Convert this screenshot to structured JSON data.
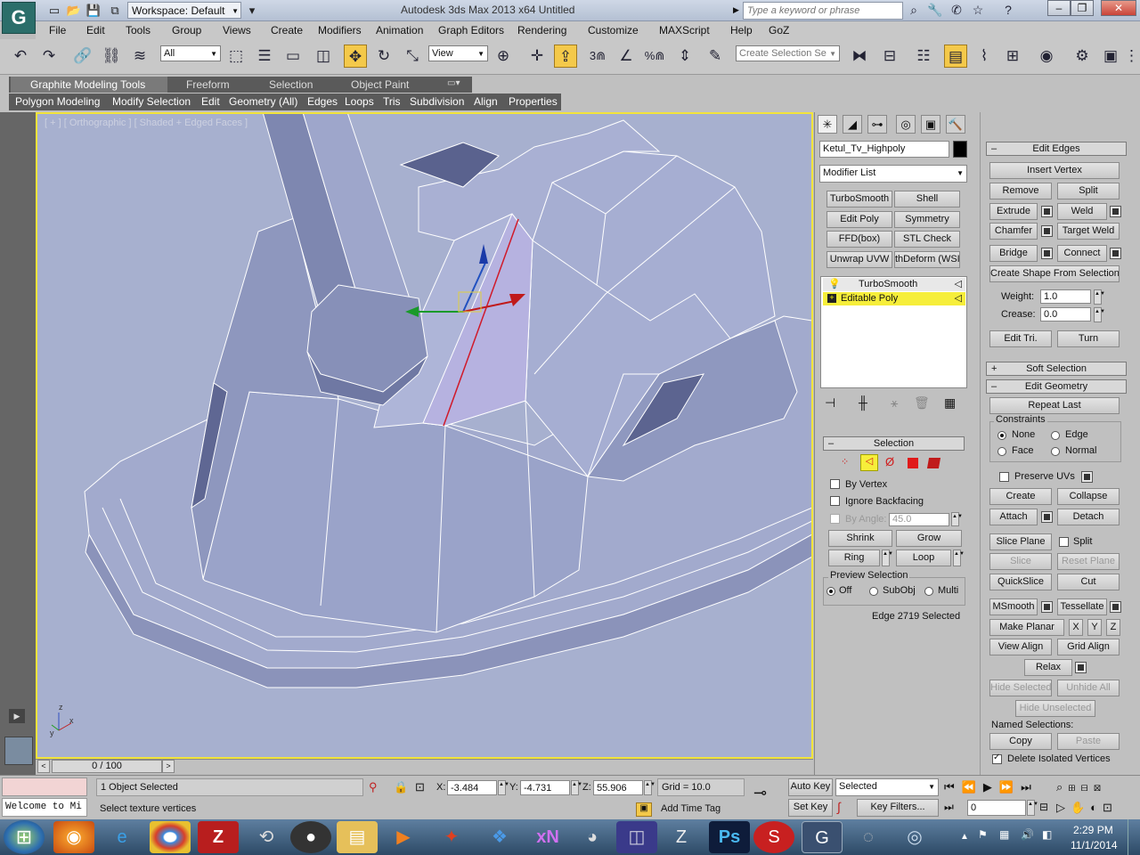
{
  "titlebar": {
    "workspace": "Workspace: Default",
    "window_title": "Autodesk 3ds Max  2013 x64      Untitled",
    "search_placeholder": "Type a keyword or phrase"
  },
  "menu": [
    "File",
    "Edit",
    "Tools",
    "Group",
    "Views",
    "Create",
    "Modifiers",
    "Animation",
    "Graph Editors",
    "Rendering",
    "Customize",
    "MAXScript",
    "Help",
    "GoZ"
  ],
  "toolbar": {
    "filter_value": "All",
    "ref_coord": "View",
    "selection_set_placeholder": "Create Selection Se",
    "snap_numbers": [
      "3",
      "%"
    ]
  },
  "ribbon": {
    "tabs": [
      "Graphite Modeling Tools",
      "Freeform",
      "Selection",
      "Object Paint"
    ],
    "subtabs": [
      "Polygon Modeling",
      "Modify Selection",
      "Edit",
      "Geometry (All)",
      "Edges",
      "Loops",
      "Tris",
      "Subdivision",
      "Align",
      "Properties"
    ]
  },
  "viewport": {
    "label": "[ + ] [ Orthographic ] [ Shaded + Edged Faces ]",
    "axis_labels": [
      "z",
      "x",
      "y"
    ]
  },
  "timeslider": {
    "value": "0 / 100"
  },
  "command_panel": {
    "object_name": "Ketul_Tv_Highpoly",
    "modifier_list": "Modifier List",
    "modifier_buttons": [
      "TurboSmooth",
      "Shell",
      "Edit Poly",
      "Symmetry",
      "FFD(box)",
      "STL Check",
      "Unwrap UVW",
      "thDeform (WSI"
    ],
    "stack": [
      "TurboSmooth",
      "Editable Poly"
    ],
    "selection": {
      "title": "Selection",
      "by_vertex": "By Vertex",
      "ignore_backfacing": "Ignore Backfacing",
      "by_angle": "By Angle:",
      "angle_value": "45.0",
      "shrink": "Shrink",
      "grow": "Grow",
      "ring": "Ring",
      "loop": "Loop",
      "preview_title": "Preview Selection",
      "preview_options": [
        "Off",
        "SubObj",
        "Multi"
      ],
      "status": "Edge 2719 Selected"
    }
  },
  "edit_edges": {
    "title": "Edit Edges",
    "insert_vertex": "Insert Vertex",
    "remove": "Remove",
    "split": "Split",
    "extrude": "Extrude",
    "weld": "Weld",
    "chamfer": "Chamfer",
    "target_weld": "Target Weld",
    "bridge": "Bridge",
    "connect": "Connect",
    "create_shape": "Create Shape From Selection",
    "weight_label": "Weight:",
    "weight_value": "1.0",
    "crease_label": "Crease:",
    "crease_value": "0.0",
    "edit_tri": "Edit Tri.",
    "turn": "Turn"
  },
  "soft_selection": {
    "title": "Soft Selection"
  },
  "edit_geometry": {
    "title": "Edit Geometry",
    "repeat_last": "Repeat Last",
    "constraints_title": "Constraints",
    "constraints": [
      "None",
      "Edge",
      "Face",
      "Normal"
    ],
    "preserve_uvs": "Preserve UVs",
    "create": "Create",
    "collapse": "Collapse",
    "attach": "Attach",
    "detach": "Detach",
    "slice_plane": "Slice Plane",
    "split": "Split",
    "slice": "Slice",
    "reset_plane": "Reset Plane",
    "quickslice": "QuickSlice",
    "cut": "Cut",
    "msmooth": "MSmooth",
    "tessellate": "Tessellate",
    "make_planar": "Make Planar",
    "x": "X",
    "y": "Y",
    "z": "Z",
    "view_align": "View Align",
    "grid_align": "Grid Align",
    "relax": "Relax",
    "hide_selected": "Hide Selected",
    "unhide_all": "Unhide All",
    "hide_unselected": "Hide Unselected",
    "named_selections": "Named Selections:",
    "copy": "Copy",
    "paste": "Paste",
    "delete_isolated": "Delete Isolated Vertices"
  },
  "status": {
    "listener": "Welcome to Mi",
    "selected": "1 Object Selected",
    "prompt": "Select texture vertices",
    "x_label": "X:",
    "x": "-3.484",
    "y_label": "Y:",
    "y": "-4.731",
    "z_label": "Z:",
    "z": "55.906",
    "grid": "Grid = 10.0",
    "auto_key": "Auto Key",
    "auto_key_mode": "Selected",
    "set_key": "Set Key",
    "key_filters": "Key Filters...",
    "add_time_tag": "Add Time Tag",
    "frame": "0"
  },
  "taskbar": {
    "time": "2:29 PM",
    "date": "11/1/2014",
    "apps": [
      "firefox",
      "internet-explorer",
      "chrome",
      "filezilla",
      "app",
      "app",
      "explorer",
      "media-player",
      "app",
      "dropbox",
      "xn",
      "app",
      "app",
      "zbrush",
      "photoshop",
      "substance",
      "3dsmax",
      "app",
      "app"
    ]
  },
  "colors": {
    "accent": "#f2e43a",
    "viewport_bg": "#a7b0cf",
    "selected_edge": "#d01a2a"
  }
}
